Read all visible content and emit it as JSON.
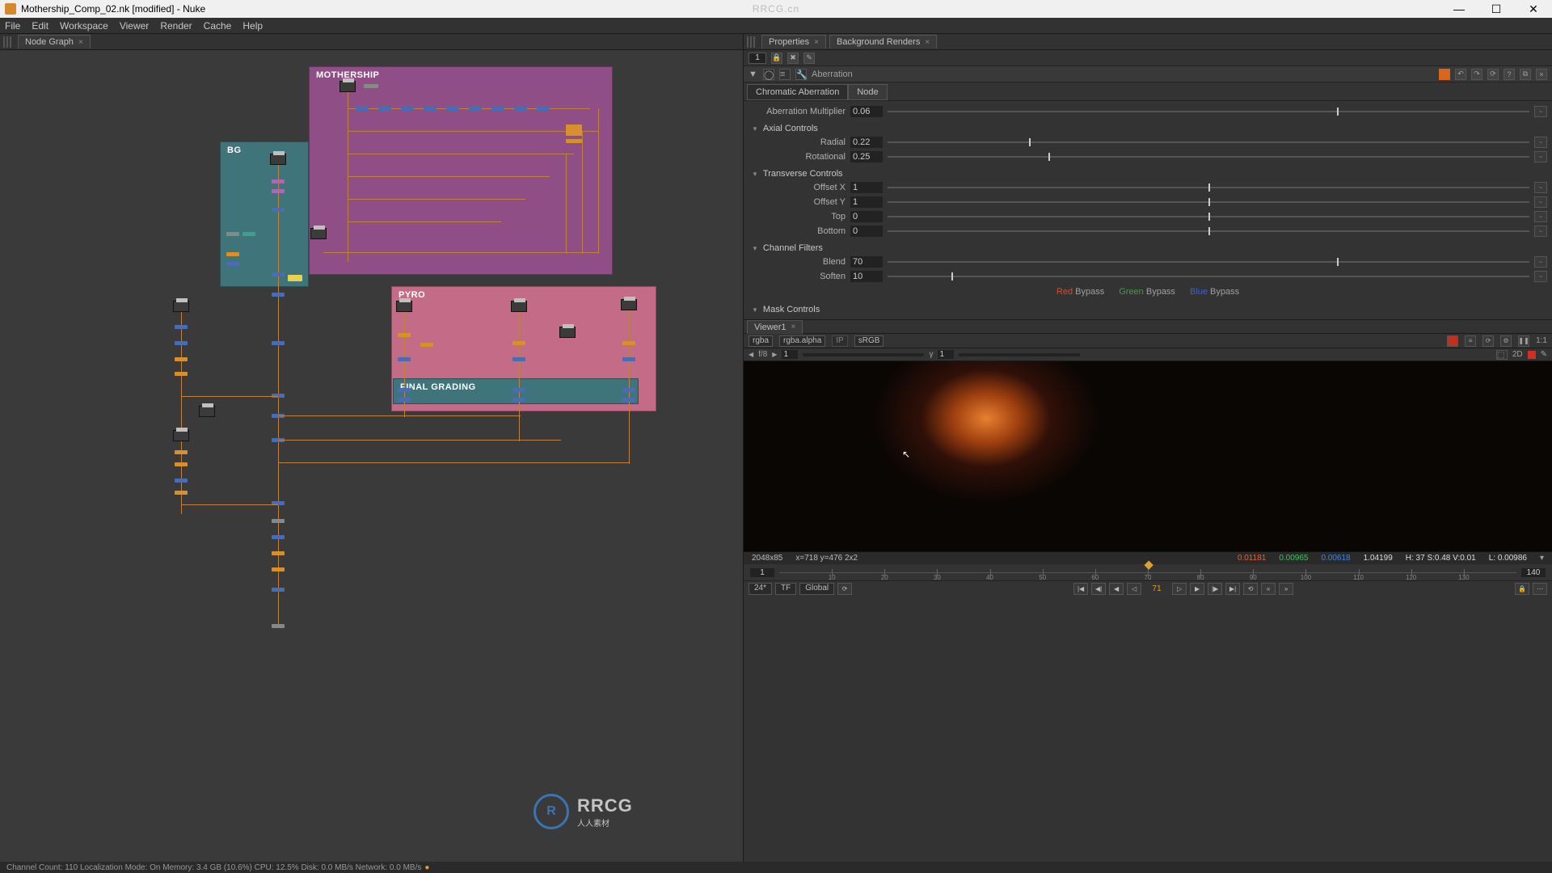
{
  "window": {
    "title": "Mothership_Comp_02.nk [modified] - Nuke",
    "watermark_top": "RRCG.cn"
  },
  "menu": [
    "File",
    "Edit",
    "Workspace",
    "Viewer",
    "Render",
    "Cache",
    "Help"
  ],
  "nodegraph_tab": "Node Graph",
  "backdrops": {
    "mothership": "MOTHERSHIP",
    "bg": "BG",
    "pyro": "PYRO",
    "final": "FINAL GRADING"
  },
  "properties": {
    "tab": "Properties",
    "tab2": "Background Renders",
    "count": "1",
    "node_name": "Aberration",
    "subtabs": [
      "Chromatic Aberration",
      "Node"
    ],
    "multiplier_label": "Aberration Multiplier",
    "multiplier_val": "0.06",
    "axial_hdr": "Axial Controls",
    "radial_label": "Radial",
    "radial_val": "0.22",
    "rotational_label": "Rotational",
    "rotational_val": "0.25",
    "transverse_hdr": "Transverse Controls",
    "offx_label": "Offset X",
    "offx_val": "1",
    "offy_label": "Offset Y",
    "offy_val": "1",
    "top_label": "Top",
    "top_val": "0",
    "bottom_label": "Bottom",
    "bottom_val": "0",
    "filters_hdr": "Channel Filters",
    "blend_label": "Blend",
    "blend_val": "70",
    "soften_label": "Soften",
    "soften_val": "10",
    "bypass": {
      "r": "Red",
      "g": "Green",
      "b": "Blue",
      "word": "Bypass"
    },
    "mask_hdr": "Mask Controls"
  },
  "viewer": {
    "tab": "Viewer1",
    "chan": "rgba",
    "alpha": "rgba.alpha",
    "ip": "IP",
    "lut": "sRGB",
    "oneone": "1:1",
    "fstop": "f/8",
    "buf1": "1",
    "gamma": "γ",
    "buf2": "1",
    "mode2d": "2D",
    "info_res": "2048x85",
    "info_xy": "x=718 y=476 2x2",
    "rv": "0.01181",
    "gv": "0.00965",
    "bv": "0.00618",
    "av": "1.04199",
    "hsv": "H: 37 S:0.48 V:0.01",
    "lum": "L: 0.00986"
  },
  "timeline": {
    "start": "1",
    "end": "140",
    "ticks": [
      "10",
      "20",
      "30",
      "40",
      "50",
      "60",
      "70",
      "80",
      "90",
      "100",
      "110",
      "120",
      "130"
    ]
  },
  "playbar": {
    "fps": "24*",
    "tf": "TF",
    "scope": "Global",
    "frame": "71"
  },
  "status": {
    "text": "Channel Count: 110 Localization Mode: On  Memory: 3.4 GB (10.6%) CPU: 12.5% Disk: 0.0 MB/s Network: 0.0 MB/s",
    "cache": "●"
  },
  "logo": {
    "big": "RRCG",
    "sm": "人人素材"
  }
}
